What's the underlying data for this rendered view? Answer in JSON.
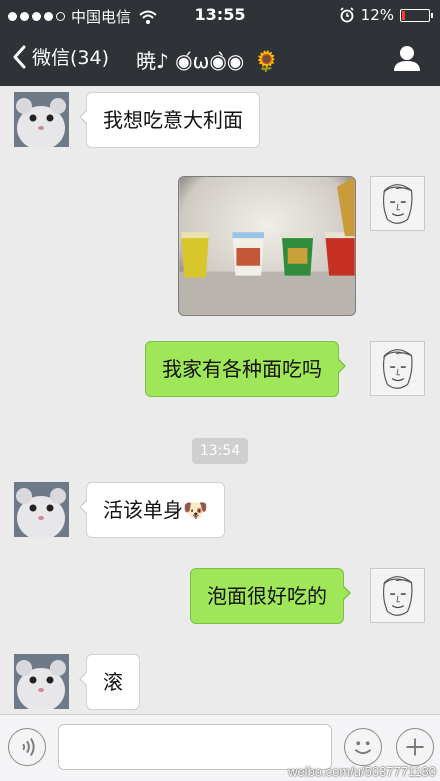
{
  "status_bar": {
    "carrier": "中国电信",
    "time": "13:55",
    "battery_percent": "12%",
    "battery_level": 0.12,
    "icons": [
      "signal-dots-icon",
      "wifi-icon",
      "alarm-icon",
      "battery-icon"
    ]
  },
  "nav": {
    "back_label": "微信(34)",
    "contact_name": "暁♪ ◉́ω◉̀◉",
    "flower_emoji": "🌻",
    "icons": [
      "chevron-left-icon",
      "person-icon"
    ]
  },
  "messages": [
    {
      "direction": "in",
      "type": "text",
      "text": "我想吃意大利面"
    },
    {
      "direction": "out",
      "type": "image",
      "description_icon": "instant-noodle-cups-photo"
    },
    {
      "direction": "out",
      "type": "text",
      "text": "我家有各种面吃吗"
    },
    {
      "direction": "system",
      "type": "timestamp",
      "text": "13:54"
    },
    {
      "direction": "in",
      "type": "text",
      "text": "活该单身🐶"
    },
    {
      "direction": "out",
      "type": "text",
      "text": "泡面很好吃的"
    },
    {
      "direction": "in",
      "type": "text",
      "text": "滚"
    }
  ],
  "input_bar": {
    "placeholder": "",
    "icons": [
      "voice-icon",
      "emoji-icon",
      "plus-icon"
    ]
  },
  "watermark": "weibo.com/u/5037771180",
  "colors": {
    "bar_bg": "#2f3236",
    "chat_bg": "#ebebeb",
    "out_bubble": "#9fe658",
    "in_bubble": "#ffffff",
    "timestamp_bg": "#cfcfcf",
    "battery_low": "#ff3b30"
  }
}
